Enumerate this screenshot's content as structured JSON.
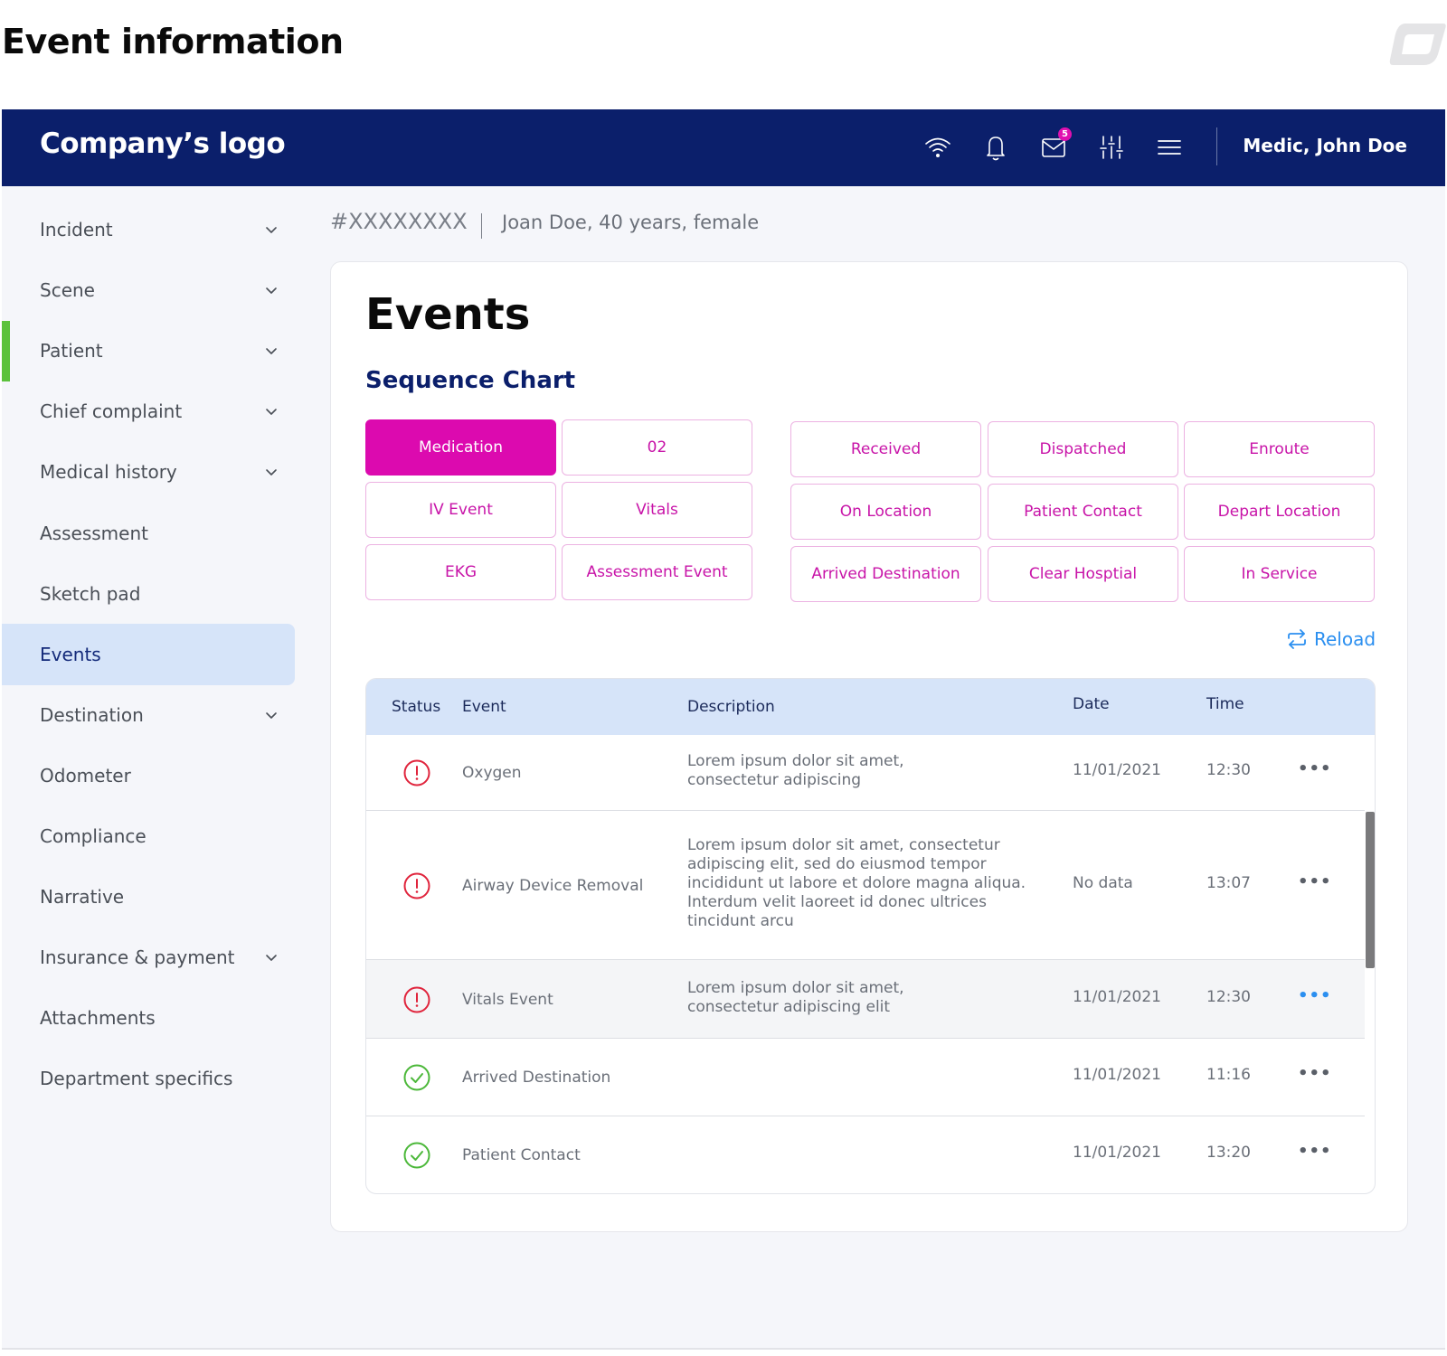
{
  "page": {
    "title": "Event information"
  },
  "topbar": {
    "logo": "Company’s logo",
    "icons": [
      "wifi-icon",
      "bell-icon",
      "mail-icon",
      "sliders-icon",
      "menu-icon"
    ],
    "mail_badge": "5",
    "user": "Medic, John Doe"
  },
  "sidebar": {
    "items": [
      {
        "label": "Incident",
        "expandable": true
      },
      {
        "label": "Scene",
        "expandable": true
      },
      {
        "label": "Patient",
        "expandable": true
      },
      {
        "label": "Chief complaint",
        "expandable": true
      },
      {
        "label": "Medical history",
        "expandable": true
      },
      {
        "label": "Assessment",
        "expandable": false
      },
      {
        "label": "Sketch pad",
        "expandable": false
      },
      {
        "label": "Events",
        "expandable": false,
        "active": true
      },
      {
        "label": "Destination",
        "expandable": true
      },
      {
        "label": "Odometer",
        "expandable": false
      },
      {
        "label": "Compliance",
        "expandable": false
      },
      {
        "label": "Narrative",
        "expandable": false
      },
      {
        "label": "Insurance & payment",
        "expandable": true
      },
      {
        "label": "Attachments",
        "expandable": false
      },
      {
        "label": "Department specifics",
        "expandable": false
      }
    ],
    "indicator_item": "Patient"
  },
  "breadcrumb": {
    "id": "#XXXXXXXX",
    "patient": "Joan Doe, 40 years, female"
  },
  "main": {
    "title": "Events",
    "subtitle": "Sequence Chart",
    "event_buttons": [
      [
        "Medication",
        "02"
      ],
      [
        "IV Event",
        "Vitals"
      ],
      [
        "EKG",
        "Assessment Event"
      ]
    ],
    "active_button": "Medication",
    "status_buttons": [
      [
        "Received",
        "Dispatched",
        "Enroute"
      ],
      [
        "On Location",
        "Patient Contact",
        "Depart Location"
      ],
      [
        "Arrived Destination",
        "Clear Hosptial",
        "In Service"
      ]
    ],
    "reload_label": "Reload"
  },
  "table": {
    "columns": [
      "Status",
      "Event",
      "Description",
      "Date",
      "Time"
    ],
    "rows": [
      {
        "status": "warning",
        "event": "Oxygen",
        "description": [
          "Lorem ipsum dolor sit amet,",
          "consectetur adipiscing"
        ],
        "date": "11/01/2021",
        "time": "12:30"
      },
      {
        "status": "warning",
        "event": "Airway Device Removal",
        "description": [
          "Lorem ipsum dolor sit amet, consectetur",
          "adipiscing elit, sed do eiusmod tempor",
          "incididunt ut labore et dolore magna aliqua.",
          "Interdum velit laoreet id donec ultrices",
          "tincidunt arcu"
        ],
        "date": "No data",
        "time": "13:07"
      },
      {
        "status": "warning",
        "event": "Vitals Event",
        "description": [
          "Lorem ipsum dolor sit amet,",
          "consectetur adipiscing elit"
        ],
        "date": "11/01/2021",
        "time": "12:30",
        "hovered": true
      },
      {
        "status": "done",
        "event": "Arrived Destination",
        "description": [],
        "date": "11/01/2021",
        "time": "11:16"
      },
      {
        "status": "done",
        "event": "Patient Contact",
        "description": [],
        "date": "11/01/2021",
        "time": "13:20"
      }
    ],
    "more_label": "•••"
  },
  "colors": {
    "navy": "#0b1f6b",
    "magenta": "#dc0aaf",
    "active_nav": "#d6e4f9",
    "indicator": "#5cc23c",
    "warning": "#e0243c",
    "success": "#4cb83a",
    "link": "#2b8ff0"
  }
}
